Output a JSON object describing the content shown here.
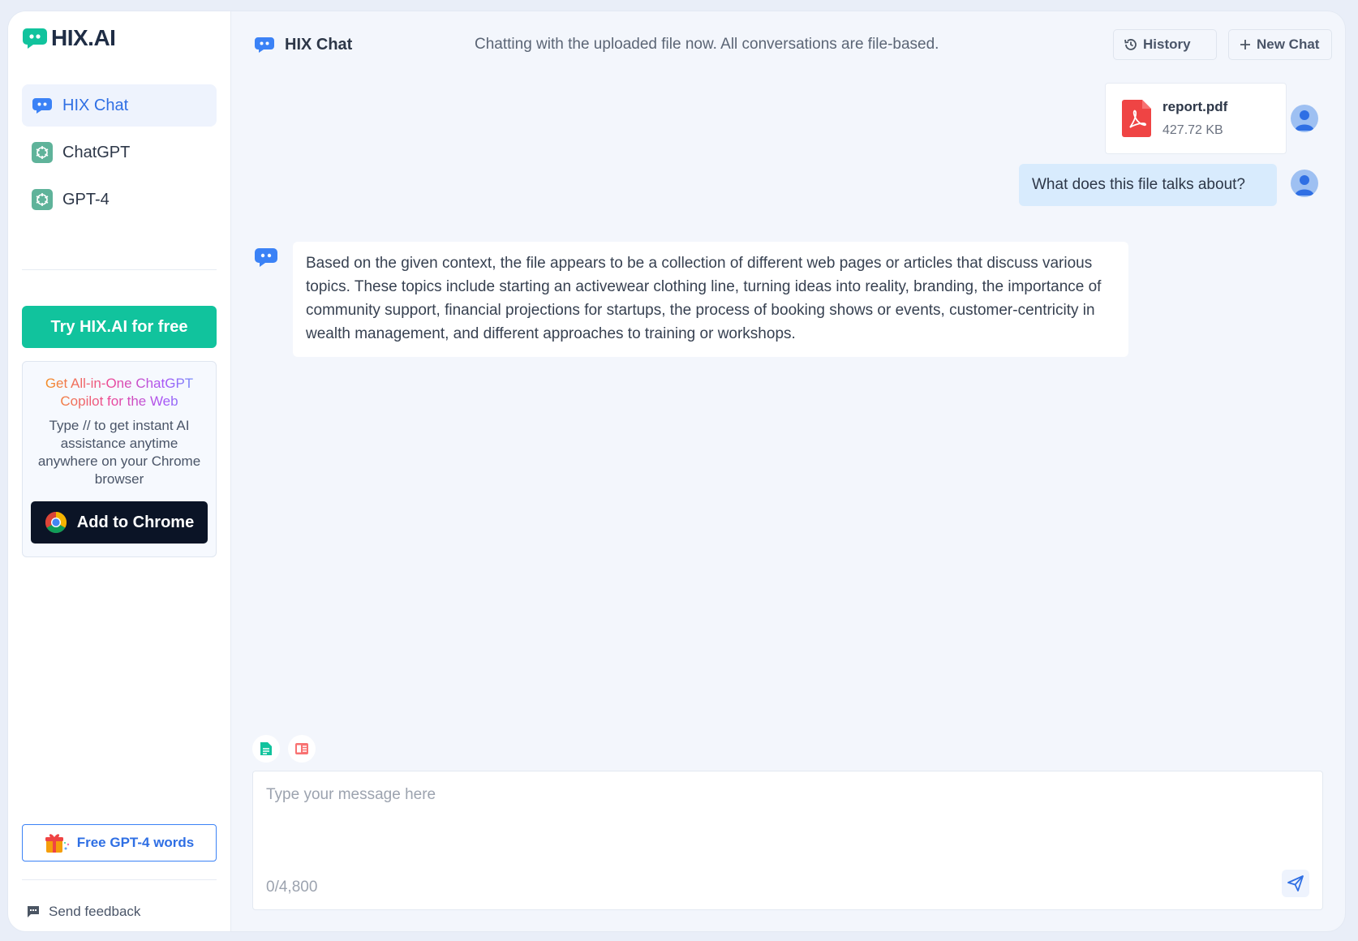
{
  "brand": {
    "name": "HIX.AI",
    "logo_icon": "chat-bubble-logo",
    "accent": "#11c39d"
  },
  "sidebar": {
    "items": [
      {
        "label": "HIX Chat",
        "icon": "hix-chat-icon",
        "active": true
      },
      {
        "label": "ChatGPT",
        "icon": "openai-icon",
        "active": false
      },
      {
        "label": "GPT-4",
        "icon": "openai-icon",
        "active": false
      }
    ],
    "try_label": "Try HIX.AI for free",
    "promo": {
      "title_line1": "Get All-in-One ChatGPT",
      "title_line2": "Copilot for the Web",
      "description": "Type // to get instant AI assistance anytime anywhere on your Chrome browser",
      "chrome_button": "Add to Chrome"
    },
    "free_words_label": "Free GPT-4 words",
    "feedback_label": "Send feedback"
  },
  "header": {
    "title": "HIX Chat",
    "notice": "Chatting with the uploaded file now. All conversations are file-based.",
    "history_label": "History",
    "new_chat_label": "New Chat"
  },
  "conversation": {
    "file": {
      "name": "report.pdf",
      "size": "427.72 KB"
    },
    "user_message": "What does this file talks about?",
    "bot_message": "Based on the given context, the file appears to be a collection of different web pages or articles that discuss various topics. These topics include starting an activewear clothing line, turning ideas into reality, branding, the importance of community support, financial projections for startups, the process of booking shows or events, customer-centricity in wealth management, and different approaches to training or workshops."
  },
  "composer": {
    "placeholder": "Type your message here",
    "value": "",
    "counter": "0/4,800"
  },
  "colors": {
    "primary_blue": "#2f6fe4",
    "user_bubble": "#d8ebfd",
    "pdf_red": "#ef4444",
    "dark_button": "#0b1426"
  }
}
